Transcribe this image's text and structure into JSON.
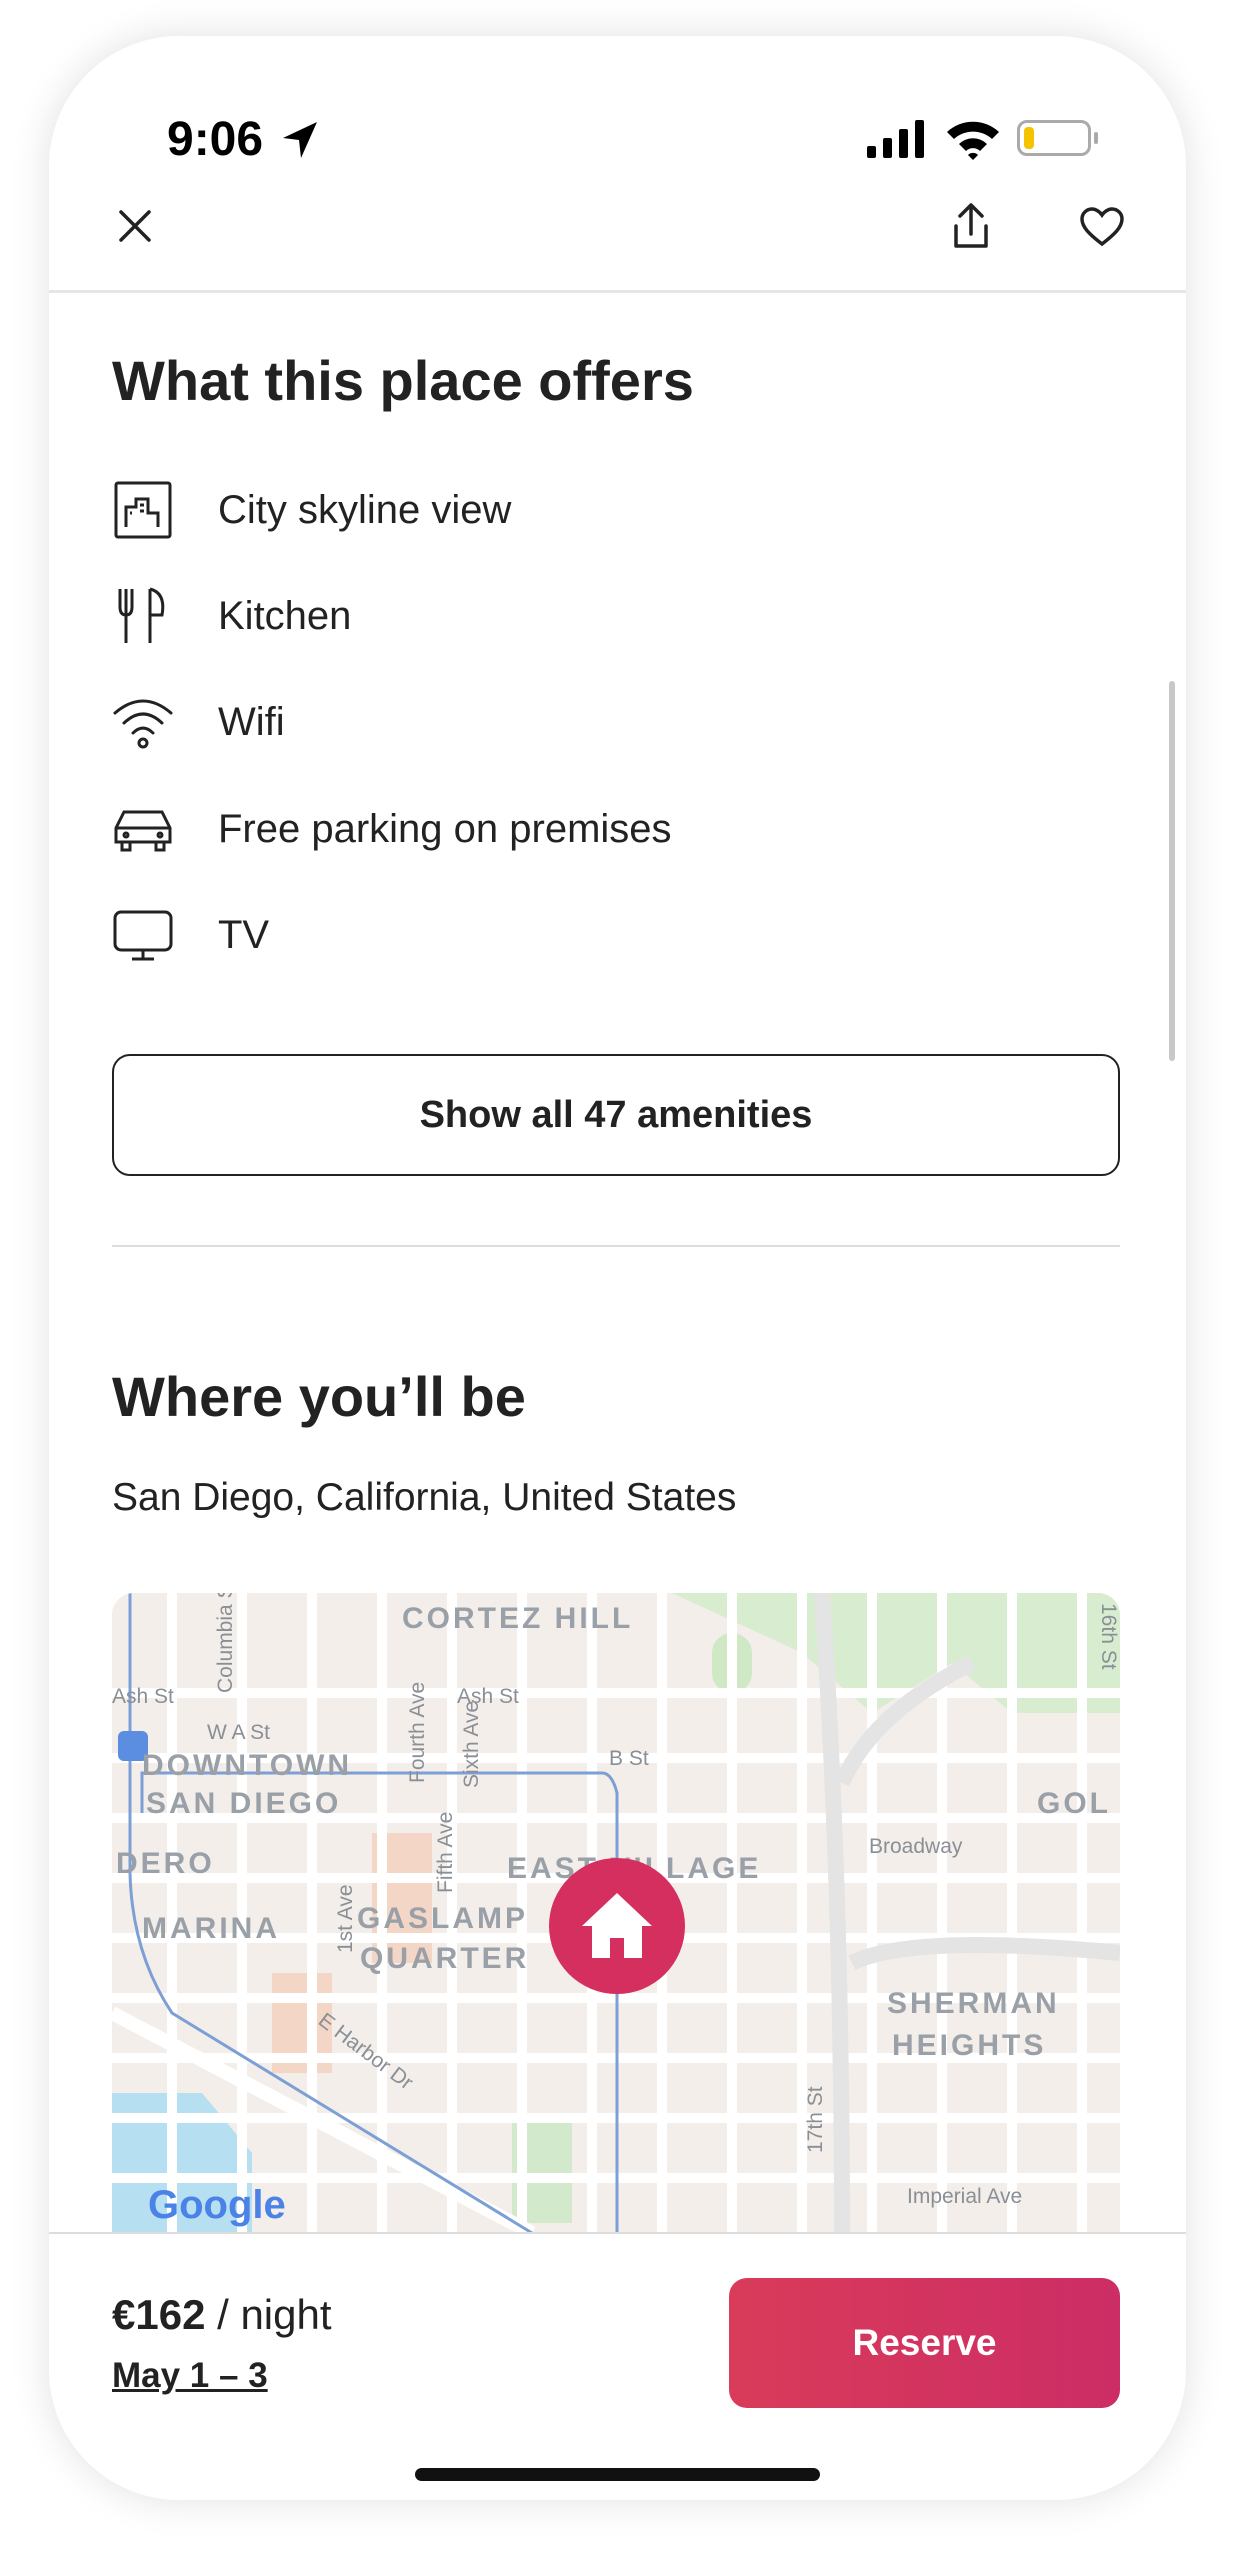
{
  "status_bar": {
    "time": "9:06",
    "icons": [
      "location-arrow-icon",
      "signal-icon",
      "wifi-icon",
      "battery-icon"
    ],
    "battery_level": 0.15
  },
  "nav": {
    "close_icon": "close-icon",
    "share_icon": "share-icon",
    "favorite_icon": "heart-icon"
  },
  "amenities": {
    "title": "What this place offers",
    "items": [
      {
        "label": "City skyline view",
        "icon": "city-view-icon"
      },
      {
        "label": "Kitchen",
        "icon": "kitchen-icon"
      },
      {
        "label": "Wifi",
        "icon": "wifi-icon"
      },
      {
        "label": "Free parking on premises",
        "icon": "car-icon"
      },
      {
        "label": "TV",
        "icon": "tv-icon"
      }
    ],
    "show_all_label": "Show all 47 amenities"
  },
  "location": {
    "title": "Where you’ll be",
    "address": "San Diego, California, United States",
    "map": {
      "labels": [
        "CORTEZ HILL",
        "DOWNTOWN",
        "SAN DIEGO",
        "DERO",
        "MARINA",
        "GASLAMP",
        "QUARTER",
        "EAST VILLAGE",
        "SHERMAN",
        "HEIGHTS",
        "GOL"
      ],
      "streets": [
        "Ash St",
        "Ash St",
        "W A St",
        "B St",
        "Broadway",
        "Columbia St",
        "Fourth Ave",
        "Sixth Ave",
        "Fifth Ave",
        "1st Ave",
        "E Harbor Dr",
        "17th St",
        "Imperial Ave",
        "16th St"
      ],
      "attribution": "Google",
      "pin_icon": "home-icon"
    }
  },
  "footer": {
    "price": "€162",
    "per_night": " / night",
    "dates": "May 1 – 3",
    "reserve_label": "Reserve",
    "accent": "#d93b5a"
  }
}
